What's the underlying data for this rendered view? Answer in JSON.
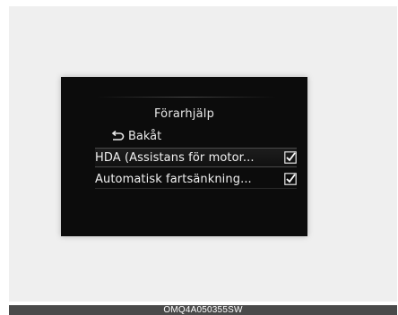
{
  "screen": {
    "title": "Förarhjälp",
    "back_label": "Bakåt",
    "items": [
      {
        "label": "HDA (Assistans för motor...",
        "checked": true,
        "icon": "checkbox-checked-icon"
      },
      {
        "label": "Automatisk fartsänkning...",
        "checked": true,
        "icon": "checkbox-checked-icon"
      }
    ],
    "back_icon": "return-arrow-icon"
  },
  "caption": "OMQ4A050355SW",
  "colors": {
    "screen_background": "#0c0c0c",
    "text": "#e8e8e8",
    "page_background": "#efefef",
    "caption_bar": "#4a4a4a"
  }
}
